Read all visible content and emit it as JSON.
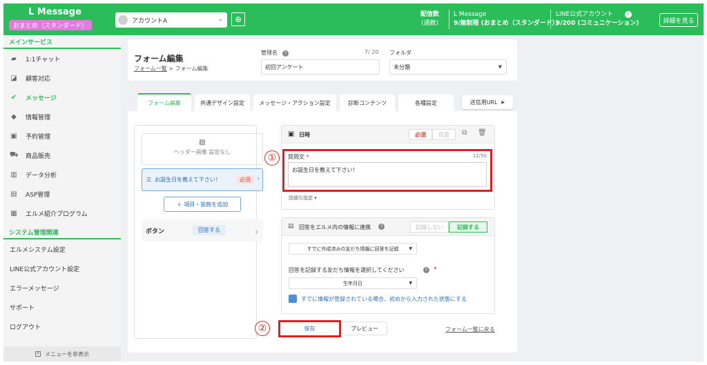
{
  "header": {
    "brand": "L Message",
    "plan_badge": "おまとめ（スタンダード）",
    "account": "アカウントA",
    "stat1_line1": "配信数",
    "stat1_line2": "(通数)",
    "stat2_line1": "L Message",
    "stat2_line2": "9/無制限 (おまとめ（スタンダード）)",
    "stat3_line1": "LINE公式アカウント",
    "stat3_line2": "9/200 (コミュニケーション)",
    "detail_button": "詳細を見る",
    "accent_color": "#2bbd5a"
  },
  "sidebar": {
    "section_main": "メインサービス",
    "items": [
      {
        "label": "1:1チャット",
        "icon": "chat-icon",
        "glyph": "▰"
      },
      {
        "label": "顧客対応",
        "icon": "edit-icon",
        "glyph": "◪"
      },
      {
        "label": "メッセージ",
        "icon": "check-icon",
        "glyph": "✔"
      },
      {
        "label": "情報管理",
        "icon": "tag-icon",
        "glyph": "◆"
      },
      {
        "label": "予約管理",
        "icon": "calendar-icon",
        "glyph": "▣"
      },
      {
        "label": "商品販売",
        "icon": "cart-icon",
        "glyph": "⛟"
      },
      {
        "label": "データ分析",
        "icon": "chart-icon",
        "glyph": "▥"
      },
      {
        "label": "ASP管理",
        "icon": "box-icon",
        "glyph": "▤"
      },
      {
        "label": "エルメ紹介プログラム",
        "icon": "badge-icon",
        "glyph": "▦"
      }
    ],
    "section_system": "システム管理関連",
    "system_items": [
      "エルメシステム設定",
      "LINE公式アカウント設定",
      "エラーメッセージ",
      "サポート",
      "ログアウト"
    ],
    "hide_menu": "メニューを非表示"
  },
  "title_panel": {
    "title": "フォーム編集",
    "breadcrumb_link": "フォーム一覧",
    "breadcrumb_sep": ">",
    "breadcrumb_current": "フォーム編集",
    "name_label": "管理名",
    "name_count": "7/ 20",
    "name_value": "初回アンケート",
    "folder_label": "フォルダ",
    "folder_value": "未分類"
  },
  "tabs": [
    "フォーム編集",
    "共通デザイン設定",
    "メッセージ・アクション設定",
    "診断コンテンツ",
    "各種設定"
  ],
  "send_url": "送信用URL",
  "left_column": {
    "header_image": "ヘッダー画像 設定なし",
    "question_item": "お誕生日を教えて下さい！",
    "required_badge": "必須",
    "add_item": "＋ 項目・装飾を追加",
    "button_section": "ボタン",
    "button_label": "回答する"
  },
  "question_box": {
    "type_label": "日時",
    "required": "必須",
    "optional": "任意",
    "question_label": "質問文",
    "char_count": "12/50",
    "question_text": "お誕生日を教えて下さい！",
    "advanced": "詳細な設定"
  },
  "link_box": {
    "title": "回答をエルメ内の情報に連携",
    "no_record": "記録しない",
    "record": "記録する",
    "select1": "すでに作成済みの友だち情報に回答を記録",
    "select_label": "回答を記録する友だち情報を選択してください",
    "select2": "生年月日",
    "checkbox_label": "すでに情報が登録されている場合、初めから入力された状態にする"
  },
  "actions": {
    "save": "保存",
    "preview": "プレビュー",
    "back": "フォーム一覧に戻る"
  },
  "annotations": {
    "one": "①",
    "two": "②"
  }
}
